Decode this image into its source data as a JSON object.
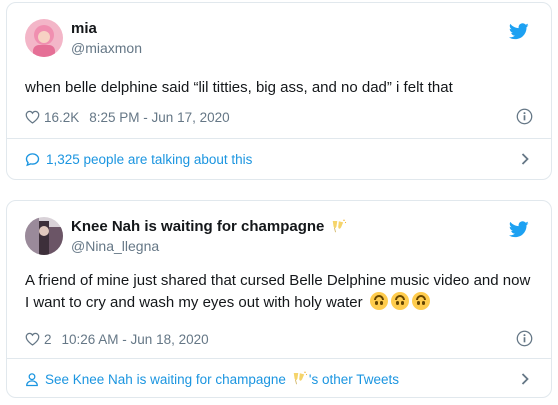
{
  "tweets": [
    {
      "display_name": "mia",
      "handle": "@miaxmon",
      "text": "when belle delphine said “lil titties, big ass, and no dad” i felt that",
      "like_count": "16.2K",
      "timestamp": "8:25 PM - Jun 17, 2020",
      "footer": "1,325 people are talking about this"
    },
    {
      "display_name": "Knee Nah is waiting for champagne",
      "handle": "@Nina_llegna",
      "text": "A friend of mine just shared that cursed Belle Delphine music video and now I want to cry and wash my eyes out with holy water",
      "like_count": "2",
      "timestamp": "10:26 AM - Jun 18, 2020",
      "footer_prefix": "See Knee Nah is waiting for champagne",
      "footer_suffix": "'s other Tweets"
    }
  ],
  "colors": {
    "link": "#1b95e0",
    "muted": "#657786",
    "border": "#e1e8ed",
    "bird": "#1da1f2"
  },
  "icons": [
    "twitter-bird-icon",
    "heart-icon",
    "info-icon",
    "speech-bubble-icon",
    "person-icon",
    "chevron-right-icon",
    "champagne-emoji",
    "upside-down-face-emoji"
  ]
}
